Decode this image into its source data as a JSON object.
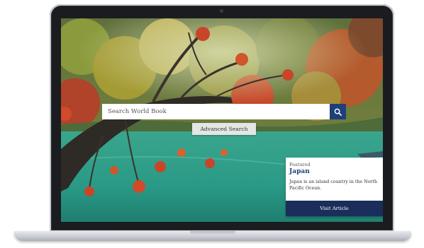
{
  "search": {
    "placeholder": "Search World Book",
    "advanced_label": "Advanced Search"
  },
  "featured": {
    "kicker": "Featured",
    "title": "Japan",
    "description": "Japan is an island country in the North Pacific Ocean.",
    "button_label": "Visit Article"
  },
  "colors": {
    "brand_blue": "#1e3f7a",
    "card_button": "#1b2d5a",
    "water": "#2fa58c"
  },
  "icons": {
    "search_button": "search-icon"
  }
}
